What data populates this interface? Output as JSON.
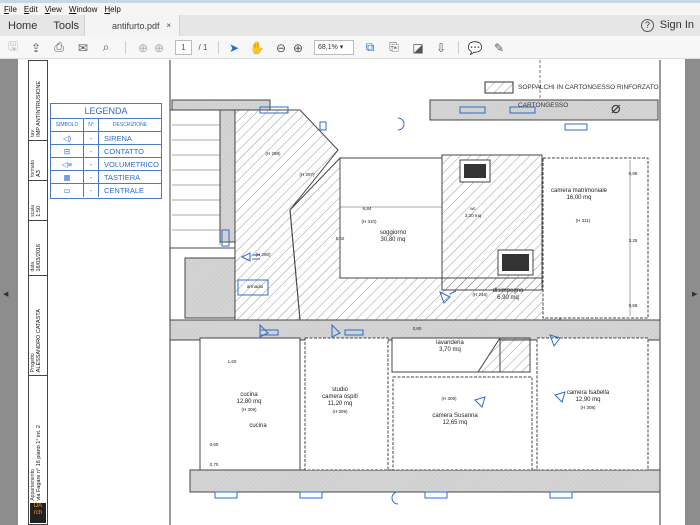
{
  "menu": [
    "File",
    "Edit",
    "View",
    "Window",
    "Help"
  ],
  "tabs": {
    "home": "Home",
    "tools": "Tools",
    "document": "antifurto.pdf",
    "close": "×",
    "sign_in": "Sign In",
    "help": "?"
  },
  "toolbar": {
    "page_current": "1",
    "page_total": "/ 1",
    "zoom": "68,1%"
  },
  "title_block": {
    "tav_label": "tav.",
    "tav": "IMP ANTINTRUSIONE",
    "formato_label": "formato",
    "formato": "A3",
    "scala_label": "scala",
    "scala": "1:50",
    "data_label": "data",
    "data": "16/03/2016",
    "progetto_label": "Progetto",
    "progetto": "ALESSANDRO CATASTA",
    "appartamento_label": "Appartamento",
    "appartamento": "via Fagare n° 16 piano 1° int. 2",
    "logo": "DA rch"
  },
  "legend": {
    "title": "LEGENDA",
    "headers": [
      "SIMBOLO",
      "N°",
      "DESCRIZIONE"
    ],
    "rows": [
      {
        "icon": "siren-icon",
        "n": "-",
        "desc": "SIRENA"
      },
      {
        "icon": "contact-icon",
        "n": "-",
        "desc": "CONTATTO"
      },
      {
        "icon": "volumetric-icon",
        "n": "-",
        "desc": "VOLUMETRICO"
      },
      {
        "icon": "keypad-icon",
        "n": "-",
        "desc": "TASTIERA"
      },
      {
        "icon": "control-panel-icon",
        "n": "-",
        "desc": "CENTRALE"
      }
    ]
  },
  "hatch_key": [
    "SOPPALCHI IN CARTONGESSO RINFORZATO",
    "CARTONGESSO"
  ],
  "rooms": {
    "soggiorno": {
      "name": "soggiorno",
      "area": "30,80 mq",
      "height": "(H 310)",
      "dim_w": "6,84",
      "dim_h": "5,02"
    },
    "matrimoniale": {
      "name": "camera matrimoniale",
      "area": "16,00 mq",
      "height": "(H 311)",
      "dims": [
        "0,89",
        "3,25",
        "0,68"
      ]
    },
    "wc": {
      "name": "wc",
      "area": "3,20 mq"
    },
    "disimpegno": {
      "name": "disimpegno",
      "area": "6,90 mq",
      "height": "(H 246)"
    },
    "lavanderia": {
      "name": "lavanderia",
      "area": "3,70 mq",
      "dim": "0,60"
    },
    "cucina": {
      "name": "cucina",
      "area": "12,80 mq",
      "height": "(H 309)",
      "label2": "cucina",
      "dims": [
        "1,60",
        "0,60",
        "0,70"
      ]
    },
    "studio": {
      "name": "studio",
      "name2": "camera ospiti",
      "area": "11,20 mq",
      "height": "(H 309)"
    },
    "susanna": {
      "name": "camera Susanna",
      "area": "12,65 mq",
      "height": "(H 309)"
    },
    "isabella": {
      "name": "camera Isabella",
      "area": "12,90 mq",
      "height": "(H 308)"
    },
    "ingresso": {
      "h1": "(H 298)",
      "h2": "(H 297)",
      "h3": "(H 290)",
      "armadio": "armadio"
    }
  },
  "colors": {
    "accent": "#2e6bd0",
    "wall": "#cfcfcf",
    "hatch": "#555555"
  }
}
